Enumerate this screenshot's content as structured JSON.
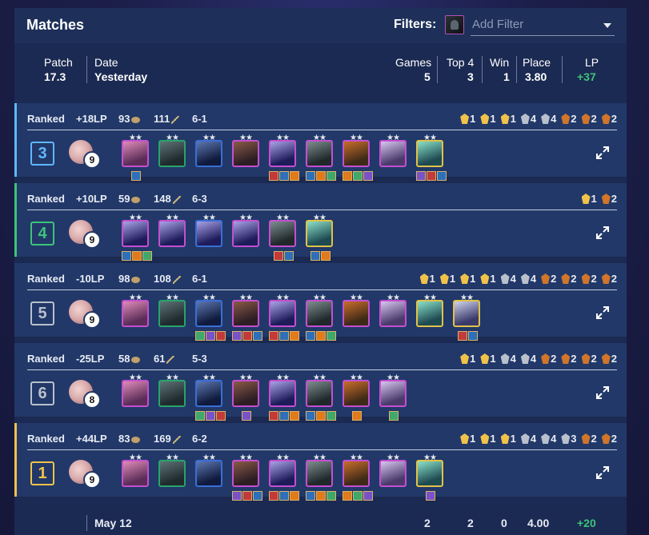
{
  "header": {
    "title": "Matches",
    "filters_label": "Filters:",
    "filter_placeholder": "Add Filter"
  },
  "summary": {
    "patch_label": "Patch",
    "patch": "17.3",
    "date_label": "Date",
    "date": "Yesterday",
    "games_label": "Games",
    "games": "5",
    "top4_label": "Top 4",
    "top4": "3",
    "win_label": "Win",
    "win": "1",
    "place_label": "Place",
    "place": "3.80",
    "lp_label": "LP",
    "lp": "+37"
  },
  "colors": {
    "gold": "#f1c24a",
    "green": "#3cc47a",
    "silver": "#b9c0cc",
    "bronze": "#d0752a",
    "blue": "#5fb8ff",
    "accent_lp": "#3cc47a"
  },
  "matches": [
    {
      "queue": "Ranked",
      "lp": "+18LP",
      "gold": "93",
      "damage": "111",
      "round": "6-1",
      "placement": "3",
      "placement_color": "#5fb8ff",
      "level": "9",
      "traits": [
        {
          "count": "1",
          "color": "#f1c24a"
        },
        {
          "count": "1",
          "color": "#f1c24a"
        },
        {
          "count": "1",
          "color": "#f1c24a"
        },
        {
          "count": "4",
          "color": "#b9c0cc"
        },
        {
          "count": "4",
          "color": "#b9c0cc"
        },
        {
          "count": "2",
          "color": "#d0752a"
        },
        {
          "count": "2",
          "color": "#d0752a"
        },
        {
          "count": "2",
          "color": "#d0752a"
        }
      ],
      "units": [
        {
          "border": "#c54fd0",
          "c1": "#5a2d58",
          "c2": "#e08cb8",
          "items": 1
        },
        {
          "border": "#29a36a",
          "c1": "#1f2a2d",
          "c2": "#5f7378",
          "items": 0
        },
        {
          "border": "#3a6ed8",
          "c1": "#0f1a3c",
          "c2": "#5e78b0",
          "items": 0
        },
        {
          "border": "#c54fd0",
          "c1": "#2d1e24",
          "c2": "#8a5a48",
          "items": 0
        },
        {
          "border": "#c54fd0",
          "c1": "#1e1c5a",
          "c2": "#aaa2e8",
          "items": 3
        },
        {
          "border": "#c54fd0",
          "c1": "#20282a",
          "c2": "#7e8e90",
          "items": 3
        },
        {
          "border": "#c54fd0",
          "c1": "#3e2a18",
          "c2": "#c86e2a",
          "items": 3
        },
        {
          "border": "#c54fd0",
          "c1": "#4a3a6c",
          "c2": "#d8c6ee",
          "items": 0
        },
        {
          "border": "#e0c248",
          "c1": "#1e4a52",
          "c2": "#8ce0c8",
          "items": 3
        }
      ]
    },
    {
      "queue": "Ranked",
      "lp": "+10LP",
      "gold": "59",
      "damage": "148",
      "round": "6-3",
      "placement": "4",
      "placement_color": "#3cc47a",
      "level": "9",
      "traits": [
        {
          "count": "1",
          "color": "#f1c24a"
        },
        {
          "count": "2",
          "color": "#d0752a"
        }
      ],
      "units": [
        {
          "border": "#c54fd0",
          "c1": "#1e1c5a",
          "c2": "#aaa2e8",
          "items": 3
        },
        {
          "border": "#c54fd0",
          "c1": "#1e1c5a",
          "c2": "#aaa2e8",
          "items": 0
        },
        {
          "border": "#3a6ed8",
          "c1": "#1e1c5a",
          "c2": "#aaa2e8",
          "items": 0
        },
        {
          "border": "#c54fd0",
          "c1": "#1e1c5a",
          "c2": "#aaa2e8",
          "items": 0
        },
        {
          "border": "#c54fd0",
          "c1": "#20282a",
          "c2": "#7e8e90",
          "items": 2
        },
        {
          "border": "#e0c248",
          "c1": "#1e4a52",
          "c2": "#8ce0c8",
          "items": 2
        }
      ]
    },
    {
      "queue": "Ranked",
      "lp": "-10LP",
      "gold": "98",
      "damage": "108",
      "round": "6-1",
      "placement": "5",
      "placement_color": "#b9c0cc",
      "level": "9",
      "traits": [
        {
          "count": "1",
          "color": "#f1c24a"
        },
        {
          "count": "1",
          "color": "#f1c24a"
        },
        {
          "count": "1",
          "color": "#f1c24a"
        },
        {
          "count": "1",
          "color": "#f1c24a"
        },
        {
          "count": "4",
          "color": "#b9c0cc"
        },
        {
          "count": "4",
          "color": "#b9c0cc"
        },
        {
          "count": "2",
          "color": "#d0752a"
        },
        {
          "count": "2",
          "color": "#d0752a"
        },
        {
          "count": "2",
          "color": "#d0752a"
        },
        {
          "count": "2",
          "color": "#d0752a"
        }
      ],
      "units": [
        {
          "border": "#c54fd0",
          "c1": "#5a2d58",
          "c2": "#e08cb8",
          "items": 0
        },
        {
          "border": "#29a36a",
          "c1": "#1f2a2d",
          "c2": "#5f7378",
          "items": 0
        },
        {
          "border": "#3a6ed8",
          "c1": "#0f1a3c",
          "c2": "#5e78b0",
          "items": 3
        },
        {
          "border": "#c54fd0",
          "c1": "#2d1e24",
          "c2": "#8a5a48",
          "items": 3
        },
        {
          "border": "#c54fd0",
          "c1": "#1e1c5a",
          "c2": "#aaa2e8",
          "items": 3
        },
        {
          "border": "#c54fd0",
          "c1": "#20282a",
          "c2": "#7e8e90",
          "items": 3
        },
        {
          "border": "#c54fd0",
          "c1": "#3e2a18",
          "c2": "#c86e2a",
          "items": 0
        },
        {
          "border": "#c54fd0",
          "c1": "#4a3a6c",
          "c2": "#d8c6ee",
          "items": 0
        },
        {
          "border": "#e0c248",
          "c1": "#1e4a52",
          "c2": "#8ce0c8",
          "items": 0
        },
        {
          "border": "#e0c248",
          "c1": "#3a3a6a",
          "c2": "#cfd2ee",
          "items": 2
        }
      ]
    },
    {
      "queue": "Ranked",
      "lp": "-25LP",
      "gold": "58",
      "damage": "61",
      "round": "5-3",
      "placement": "6",
      "placement_color": "#b9c0cc",
      "level": "8",
      "traits": [
        {
          "count": "1",
          "color": "#f1c24a"
        },
        {
          "count": "1",
          "color": "#f1c24a"
        },
        {
          "count": "4",
          "color": "#b9c0cc"
        },
        {
          "count": "4",
          "color": "#b9c0cc"
        },
        {
          "count": "2",
          "color": "#d0752a"
        },
        {
          "count": "2",
          "color": "#d0752a"
        },
        {
          "count": "2",
          "color": "#d0752a"
        },
        {
          "count": "2",
          "color": "#d0752a"
        }
      ],
      "units": [
        {
          "border": "#c54fd0",
          "c1": "#5a2d58",
          "c2": "#e08cb8",
          "items": 0
        },
        {
          "border": "#29a36a",
          "c1": "#1f2a2d",
          "c2": "#5f7378",
          "items": 0
        },
        {
          "border": "#3a6ed8",
          "c1": "#0f1a3c",
          "c2": "#5e78b0",
          "items": 3
        },
        {
          "border": "#c54fd0",
          "c1": "#2d1e24",
          "c2": "#8a5a48",
          "items": 1
        },
        {
          "border": "#c54fd0",
          "c1": "#1e1c5a",
          "c2": "#aaa2e8",
          "items": 3
        },
        {
          "border": "#c54fd0",
          "c1": "#20282a",
          "c2": "#7e8e90",
          "items": 3
        },
        {
          "border": "#c54fd0",
          "c1": "#3e2a18",
          "c2": "#c86e2a",
          "items": 1
        },
        {
          "border": "#c54fd0",
          "c1": "#4a3a6c",
          "c2": "#d8c6ee",
          "items": 1
        }
      ]
    },
    {
      "queue": "Ranked",
      "lp": "+44LP",
      "gold": "83",
      "damage": "169",
      "round": "6-2",
      "placement": "1",
      "placement_color": "#f1c24a",
      "level": "9",
      "traits": [
        {
          "count": "1",
          "color": "#f1c24a"
        },
        {
          "count": "1",
          "color": "#f1c24a"
        },
        {
          "count": "1",
          "color": "#f1c24a"
        },
        {
          "count": "4",
          "color": "#b9c0cc"
        },
        {
          "count": "4",
          "color": "#b9c0cc"
        },
        {
          "count": "3",
          "color": "#b9c0cc"
        },
        {
          "count": "2",
          "color": "#d0752a"
        },
        {
          "count": "2",
          "color": "#d0752a"
        }
      ],
      "units": [
        {
          "border": "#c54fd0",
          "c1": "#5a2d58",
          "c2": "#e08cb8",
          "items": 0
        },
        {
          "border": "#29a36a",
          "c1": "#1f2a2d",
          "c2": "#5f7378",
          "items": 0
        },
        {
          "border": "#3a6ed8",
          "c1": "#0f1a3c",
          "c2": "#5e78b0",
          "items": 0
        },
        {
          "border": "#c54fd0",
          "c1": "#2d1e24",
          "c2": "#8a5a48",
          "items": 3
        },
        {
          "border": "#c54fd0",
          "c1": "#1e1c5a",
          "c2": "#aaa2e8",
          "items": 3
        },
        {
          "border": "#c54fd0",
          "c1": "#20282a",
          "c2": "#7e8e90",
          "items": 3
        },
        {
          "border": "#c54fd0",
          "c1": "#3e2a18",
          "c2": "#c86e2a",
          "items": 3
        },
        {
          "border": "#c54fd0",
          "c1": "#4a3a6c",
          "c2": "#d8c6ee",
          "items": 0
        },
        {
          "border": "#e0c248",
          "c1": "#1e4a52",
          "c2": "#8ce0c8",
          "items": 1
        }
      ]
    }
  ],
  "footer": {
    "date": "May 12",
    "games": "2",
    "top4": "2",
    "win": "0",
    "place": "4.00",
    "lp": "+20"
  }
}
